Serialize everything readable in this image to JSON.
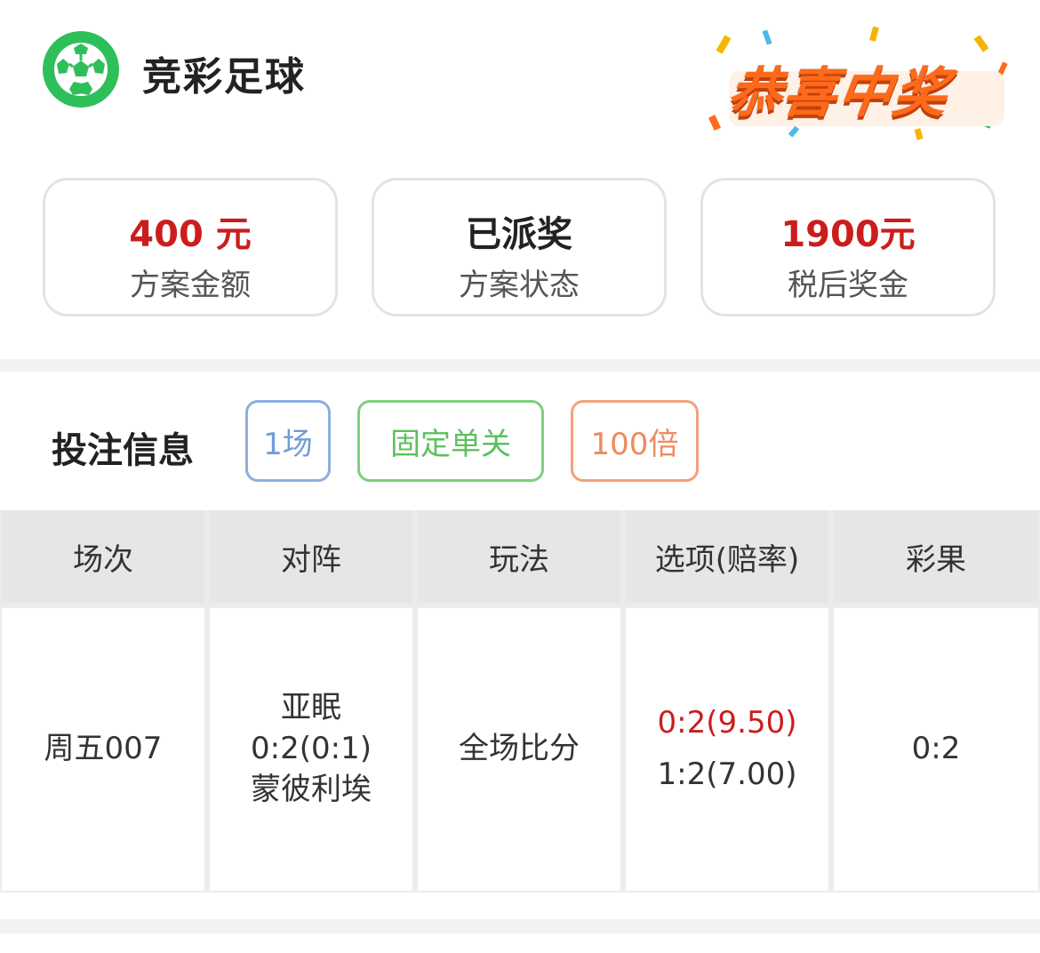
{
  "header": {
    "app_title": "竞彩足球",
    "logo_icon": "soccer-ball-icon",
    "win_badge": "恭喜中奖",
    "colors": {
      "logo": "#2fbf5a",
      "badge": "#ff6a1a"
    }
  },
  "summary": {
    "amount": {
      "value": "400 元",
      "label": "方案金额"
    },
    "status": {
      "value": "已派奖",
      "label": "方案状态"
    },
    "prize": {
      "value": "1900元",
      "label": "税后奖金"
    }
  },
  "bet_info": {
    "title": "投注信息",
    "tags": {
      "matches": "1场",
      "type": "固定单关",
      "multiplier": "100倍"
    }
  },
  "table": {
    "headers": [
      "场次",
      "对阵",
      "玩法",
      "选项(赔率)",
      "彩果"
    ],
    "row": {
      "match_no": "周五007",
      "home": "亚眠",
      "score": "0:2(0:1)",
      "away": "蒙彼利埃",
      "play": "全场比分",
      "option_won": "0:2(9.50)",
      "option_other": "1:2(7.00)",
      "result": "0:2"
    }
  }
}
